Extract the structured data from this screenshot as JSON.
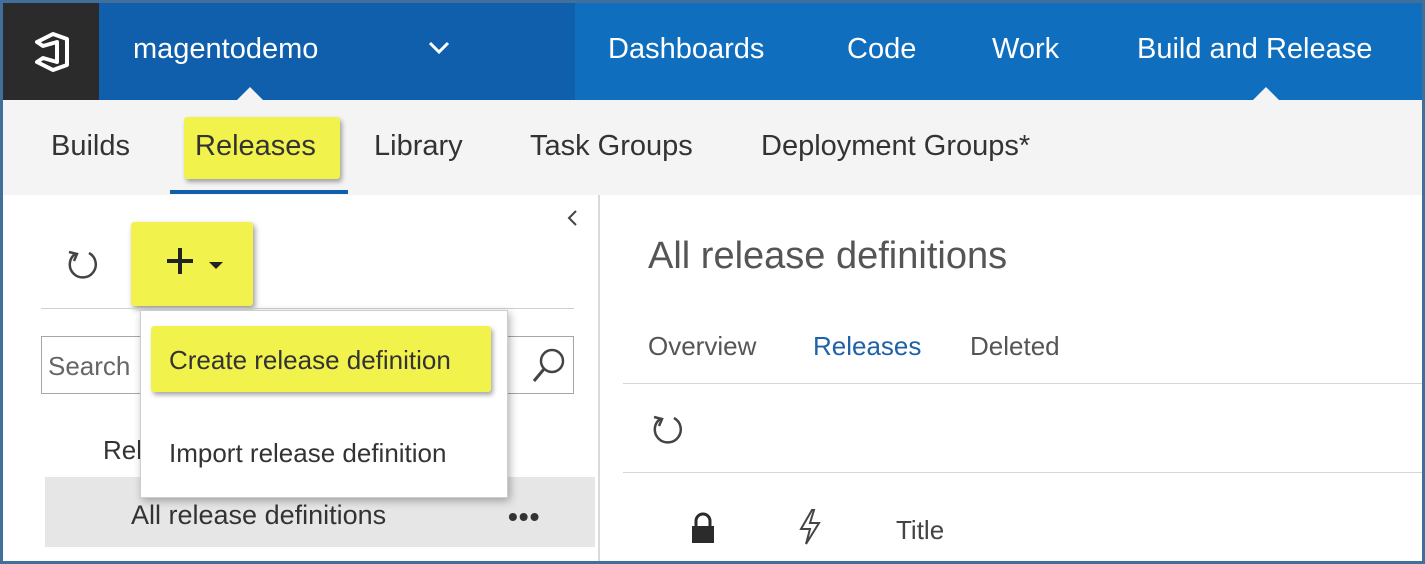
{
  "header": {
    "project_name": "magentodemo",
    "hubs": [
      {
        "label": "Dashboards"
      },
      {
        "label": "Code"
      },
      {
        "label": "Work"
      },
      {
        "label": "Build and Release"
      }
    ]
  },
  "subnav": {
    "items": [
      {
        "label": "Builds"
      },
      {
        "label": "Releases"
      },
      {
        "label": "Library"
      },
      {
        "label": "Task Groups"
      },
      {
        "label": "Deployment Groups*"
      }
    ],
    "selected": "Releases"
  },
  "left_panel": {
    "search_placeholder": "Search",
    "section_label_cut": "Rel",
    "definitions_item": "All release definitions",
    "more_label": "•••"
  },
  "add_menu": {
    "items": [
      {
        "label": "Create release definition"
      },
      {
        "label": "Import release definition"
      }
    ]
  },
  "main": {
    "title": "All release definitions",
    "tabs": [
      {
        "label": "Overview"
      },
      {
        "label": "Releases"
      },
      {
        "label": "Deleted"
      }
    ],
    "active_tab": "Releases",
    "column_title": "Title"
  },
  "colors": {
    "topbar": "#106ebe",
    "project_bg": "#0f5fad",
    "highlight": "#f2f24d",
    "active_tab": "#1f62a8"
  },
  "icons": {
    "logo": "vsts-logo-icon",
    "chevron": "chevron-down-icon",
    "refresh": "refresh-icon",
    "add": "plus-icon",
    "search": "search-icon",
    "lock": "lock-icon",
    "trigger": "lightning-icon"
  }
}
